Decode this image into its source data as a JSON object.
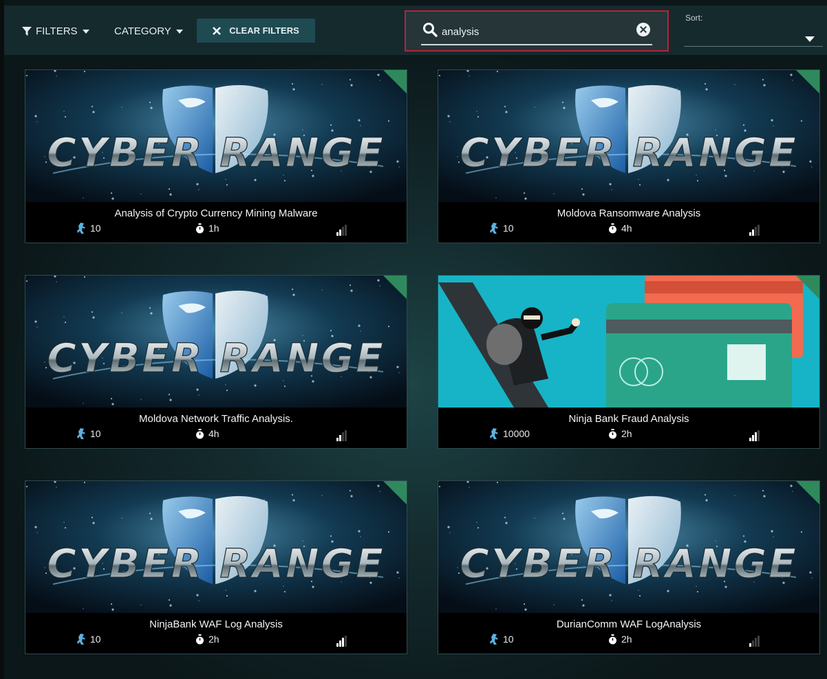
{
  "toolbar": {
    "filters_label": "FILTERS",
    "category_label": "CATEGORY",
    "clear_filters_label": "CLEAR FILTERS"
  },
  "search": {
    "value": "analysis",
    "placeholder": ""
  },
  "sort": {
    "label": "Sort:",
    "value": ""
  },
  "colors": {
    "search_border": "#b3243a",
    "clear_button_bg": "#1e4a52",
    "corner_badge": "#2e8a5c"
  },
  "cards": [
    {
      "title": "Analysis of Crypto Currency Mining Malware",
      "points": "10",
      "duration": "1h",
      "image": "cyber-range",
      "difficulty": 2
    },
    {
      "title": "Moldova Ransomware Analysis",
      "points": "10",
      "duration": "4h",
      "image": "cyber-range",
      "difficulty": 2
    },
    {
      "title": "Moldova Network Traffic Analysis.",
      "points": "10",
      "duration": "4h",
      "image": "cyber-range",
      "difficulty": 2
    },
    {
      "title": "Ninja Bank Fraud Analysis",
      "points": "10000",
      "duration": "2h",
      "image": "credit-card-thief",
      "difficulty": 3
    },
    {
      "title": "NinjaBank WAF Log Analysis",
      "points": "10",
      "duration": "2h",
      "image": "cyber-range",
      "difficulty": 3
    },
    {
      "title": "DurianComm WAF LogAnalysis",
      "points": "10",
      "duration": "2h",
      "image": "cyber-range",
      "difficulty": 1
    }
  ],
  "banner_text": "CYBER RANGE",
  "icons": {
    "points": "points-figure-icon",
    "duration": "stopwatch-icon",
    "difficulty": "signal-bars-icon"
  }
}
